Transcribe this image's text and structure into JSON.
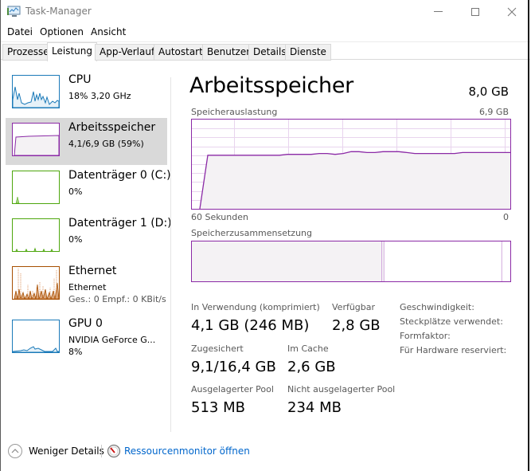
{
  "window": {
    "title": "Task-Manager"
  },
  "menu": [
    "Datei",
    "Optionen",
    "Ansicht"
  ],
  "tabs": [
    {
      "label": "Prozesse",
      "active": false
    },
    {
      "label": "Leistung",
      "active": true
    },
    {
      "label": "App-Verlauf",
      "active": false
    },
    {
      "label": "Autostart",
      "active": false
    },
    {
      "label": "Benutzer",
      "active": false
    },
    {
      "label": "Details",
      "active": false
    },
    {
      "label": "Dienste",
      "active": false
    }
  ],
  "sidebar": [
    {
      "title": "CPU",
      "line1": "18% 3,20 GHz",
      "color": "#1b7ab9"
    },
    {
      "title": "Arbeitsspeicher",
      "line1": "4,1/6,9 GB (59%)",
      "color": "#8b2aa6",
      "selected": true
    },
    {
      "title": "Datenträger 0 (C:)",
      "line1": "0%",
      "color": "#4da60c"
    },
    {
      "title": "Datenträger 1 (D:)",
      "line1": "0%",
      "color": "#4da60c"
    },
    {
      "title": "Ethernet",
      "line1": "Ethernet",
      "line2": "Ges.: 0 Empf.: 0 KBit/s",
      "color": "#a74f01"
    },
    {
      "title": "GPU 0",
      "line1": "NVIDIA GeForce G...",
      "line2": "8%",
      "color": "#1b7ab9"
    }
  ],
  "main": {
    "title": "Arbeitsspeicher",
    "total": "8,0 GB",
    "usage_label": "Speicherauslastung",
    "usage_max": "6,9 GB",
    "x_left": "60 Sekunden",
    "x_right": "0",
    "composition_label": "Speicherzusammensetzung",
    "usage_history_fraction": [
      0,
      0,
      0.6,
      0.6,
      0.6,
      0.6,
      0.6,
      0.6,
      0.6,
      0.6,
      0.6,
      0.6,
      0.61,
      0.61,
      0.61,
      0.61,
      0.62,
      0.62,
      0.61,
      0.62,
      0.64,
      0.64,
      0.63,
      0.63,
      0.64,
      0.64,
      0.64,
      0.63,
      0.62,
      0.62,
      0.62,
      0.62,
      0.62,
      0.62,
      0.63,
      0.63,
      0.63,
      0.63,
      0.63,
      0.63,
      0.63
    ],
    "composition": {
      "in_use_fraction": 0.595,
      "modified_fraction": 0.007,
      "standby_fraction": 0.37,
      "free_fraction": 0.028
    },
    "stats": [
      {
        "label": "In Verwendung (komprimiert)",
        "value": "4,1 GB (246 MB)"
      },
      {
        "label": "Verfügbar",
        "value": "2,8 GB"
      },
      {
        "label": "Zugesichert",
        "value": "9,1/16,4 GB"
      },
      {
        "label": "Im Cache",
        "value": "2,6 GB"
      },
      {
        "label": "Ausgelagerter Pool",
        "value": "513 MB"
      },
      {
        "label": "Nicht ausgelagerter Pool",
        "value": "234 MB"
      }
    ],
    "hw": [
      "Geschwindigkeit:",
      "Steckplätze verwendet:",
      "Formfaktor:",
      "Für Hardware reserviert:"
    ]
  },
  "footer": {
    "less_details": "Weniger Details",
    "resmon": "Ressourcenmonitor öffnen"
  },
  "colors": {
    "memory": "#8b2aa6",
    "memory_fill": "#f4f2f4",
    "grid": "#e8d4ee",
    "link": "#0066cc"
  }
}
